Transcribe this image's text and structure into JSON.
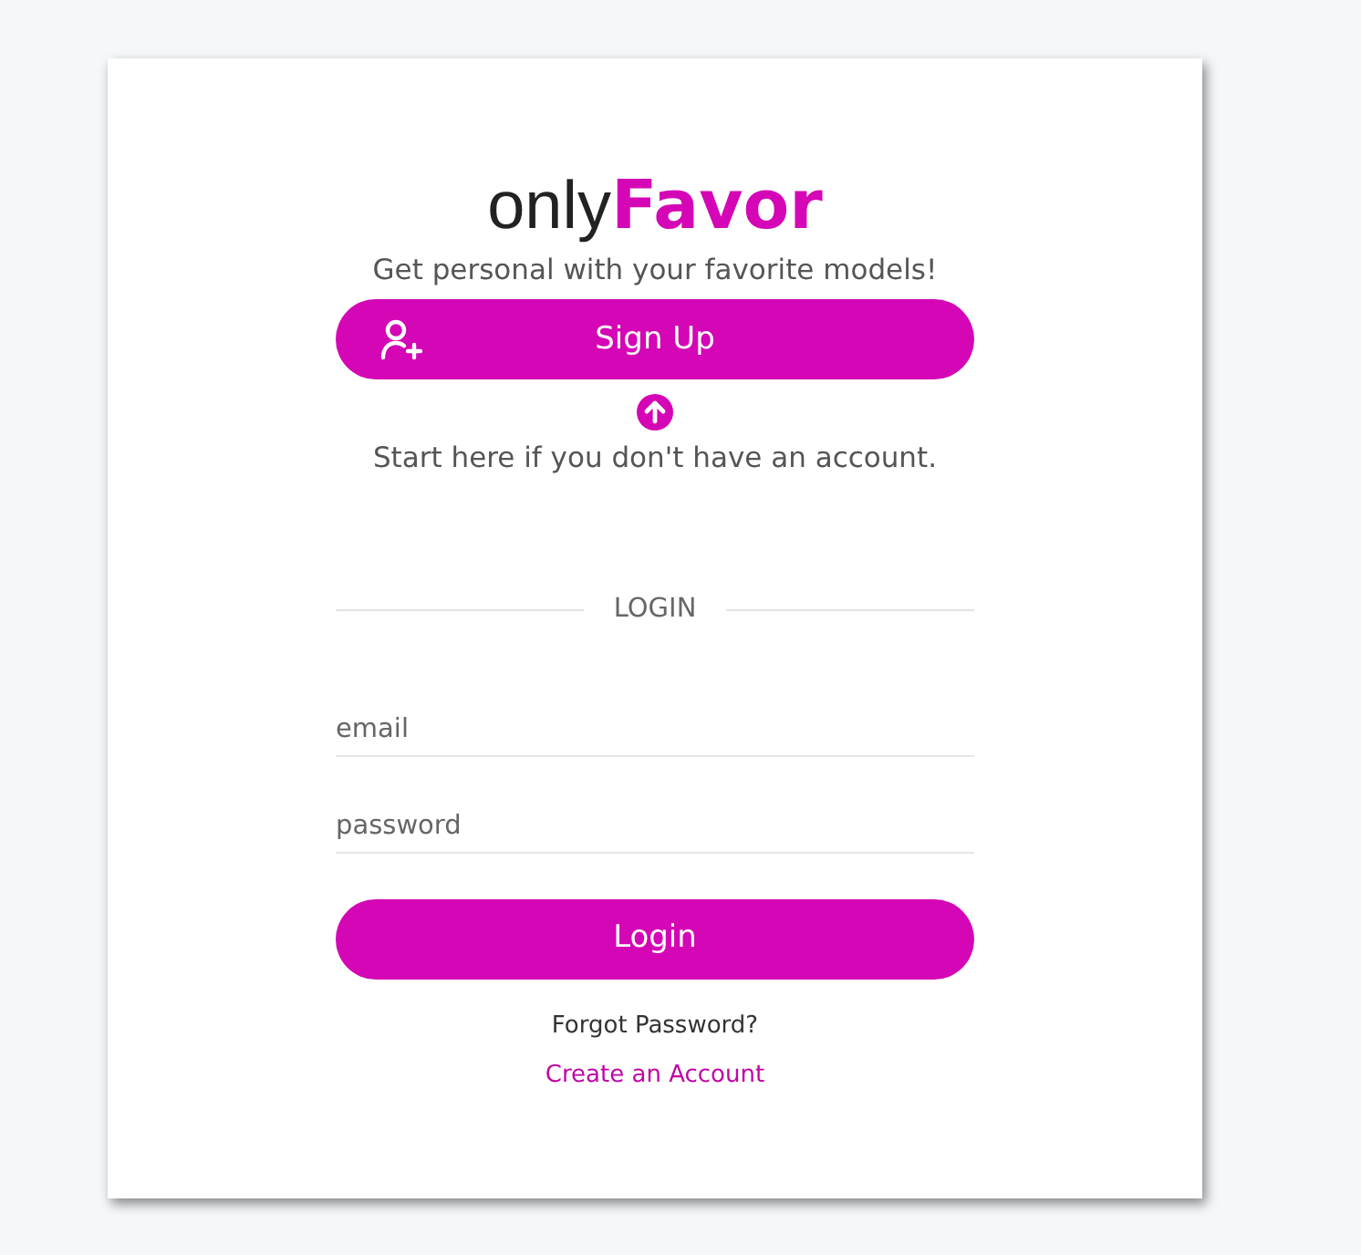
{
  "logo": {
    "prefix": "only",
    "accent": "Favor"
  },
  "tagline": "Get personal with your favorite models!",
  "signup_button": {
    "label": "Sign Up"
  },
  "signup_hint": "Start here if you don't have an account.",
  "divider_label": "LOGIN",
  "fields": [
    {
      "placeholder": "email"
    },
    {
      "placeholder": "password"
    }
  ],
  "login_button": {
    "label": "Login"
  },
  "forgot_link": "Forgot Password?",
  "create_link": "Create an Account"
}
